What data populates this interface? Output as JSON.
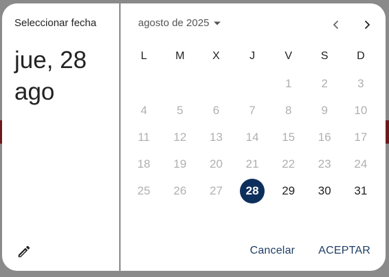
{
  "dialog": {
    "help_text": "Seleccionar fecha",
    "headline": "jue, 28 ago",
    "month_label": "agosto de 2025",
    "weekdays": [
      "L",
      "M",
      "X",
      "J",
      "V",
      "S",
      "D"
    ],
    "leading_blanks": 4,
    "days": [
      {
        "d": "1",
        "enabled": false
      },
      {
        "d": "2",
        "enabled": false
      },
      {
        "d": "3",
        "enabled": false
      },
      {
        "d": "4",
        "enabled": false
      },
      {
        "d": "5",
        "enabled": false
      },
      {
        "d": "6",
        "enabled": false
      },
      {
        "d": "7",
        "enabled": false
      },
      {
        "d": "8",
        "enabled": false
      },
      {
        "d": "9",
        "enabled": false
      },
      {
        "d": "10",
        "enabled": false
      },
      {
        "d": "11",
        "enabled": false
      },
      {
        "d": "12",
        "enabled": false
      },
      {
        "d": "13",
        "enabled": false
      },
      {
        "d": "14",
        "enabled": false
      },
      {
        "d": "15",
        "enabled": false
      },
      {
        "d": "16",
        "enabled": false
      },
      {
        "d": "17",
        "enabled": false
      },
      {
        "d": "18",
        "enabled": false
      },
      {
        "d": "19",
        "enabled": false
      },
      {
        "d": "20",
        "enabled": false
      },
      {
        "d": "21",
        "enabled": false
      },
      {
        "d": "22",
        "enabled": false
      },
      {
        "d": "23",
        "enabled": false
      },
      {
        "d": "24",
        "enabled": false
      },
      {
        "d": "25",
        "enabled": false
      },
      {
        "d": "26",
        "enabled": false
      },
      {
        "d": "27",
        "enabled": false
      },
      {
        "d": "28",
        "enabled": true,
        "selected": true
      },
      {
        "d": "29",
        "enabled": true
      },
      {
        "d": "30",
        "enabled": true
      },
      {
        "d": "31",
        "enabled": true
      }
    ],
    "cancel_label": "Cancelar",
    "ok_label": "ACEPTAR",
    "icons": {
      "edit": "pencil-icon",
      "dropdown": "dropdown-arrow-icon",
      "prev": "chevron-left-icon",
      "next": "chevron-right-icon"
    },
    "colors": {
      "selected_bg": "#0d2f5c",
      "action_text": "#1f3d66",
      "disabled_text": "#b0b0b0"
    }
  }
}
